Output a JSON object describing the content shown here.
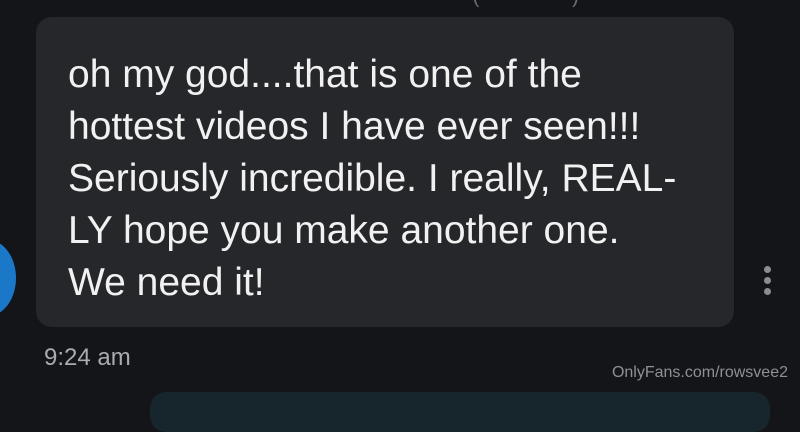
{
  "message": {
    "text": "oh my god....that is one of the\nhottest videos I have ever seen!!!\nSeriously incredible. I really, REAL-\nLY hope you make another one.\nWe need it!",
    "timestamp": "9:24 am"
  },
  "watermark": "OnlyFans.com/rowsvee2",
  "icons": {
    "more_options": "more-vertical-icon"
  },
  "colors": {
    "background": "#141518",
    "bubble": "#26272b",
    "avatar": "#1b78c9",
    "outgoing_bubble": "#17252d"
  }
}
